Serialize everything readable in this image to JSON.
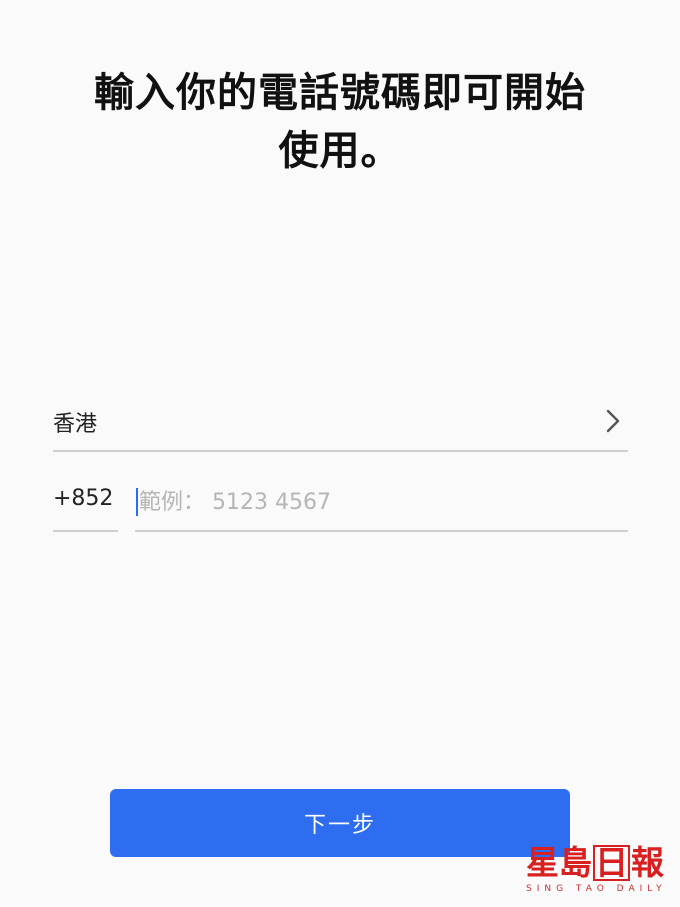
{
  "header": {
    "title_line1": "輸入你的電話號碼即可開始",
    "title_line2": "使用。"
  },
  "form": {
    "country": {
      "label": "香港",
      "icon": "chevron-right-icon"
    },
    "country_code": "+852",
    "phone": {
      "value": "",
      "placeholder": "範例： 5123 4567"
    }
  },
  "footer": {
    "next_label": "下一步"
  },
  "watermark": {
    "chars": [
      "星",
      "島",
      "日",
      "報"
    ],
    "subtitle": "SING TAO DAILY"
  },
  "colors": {
    "accent": "#2f6df0",
    "divider": "#cfcfcf",
    "placeholder": "#b5b5b5",
    "watermark": "#d82020"
  }
}
